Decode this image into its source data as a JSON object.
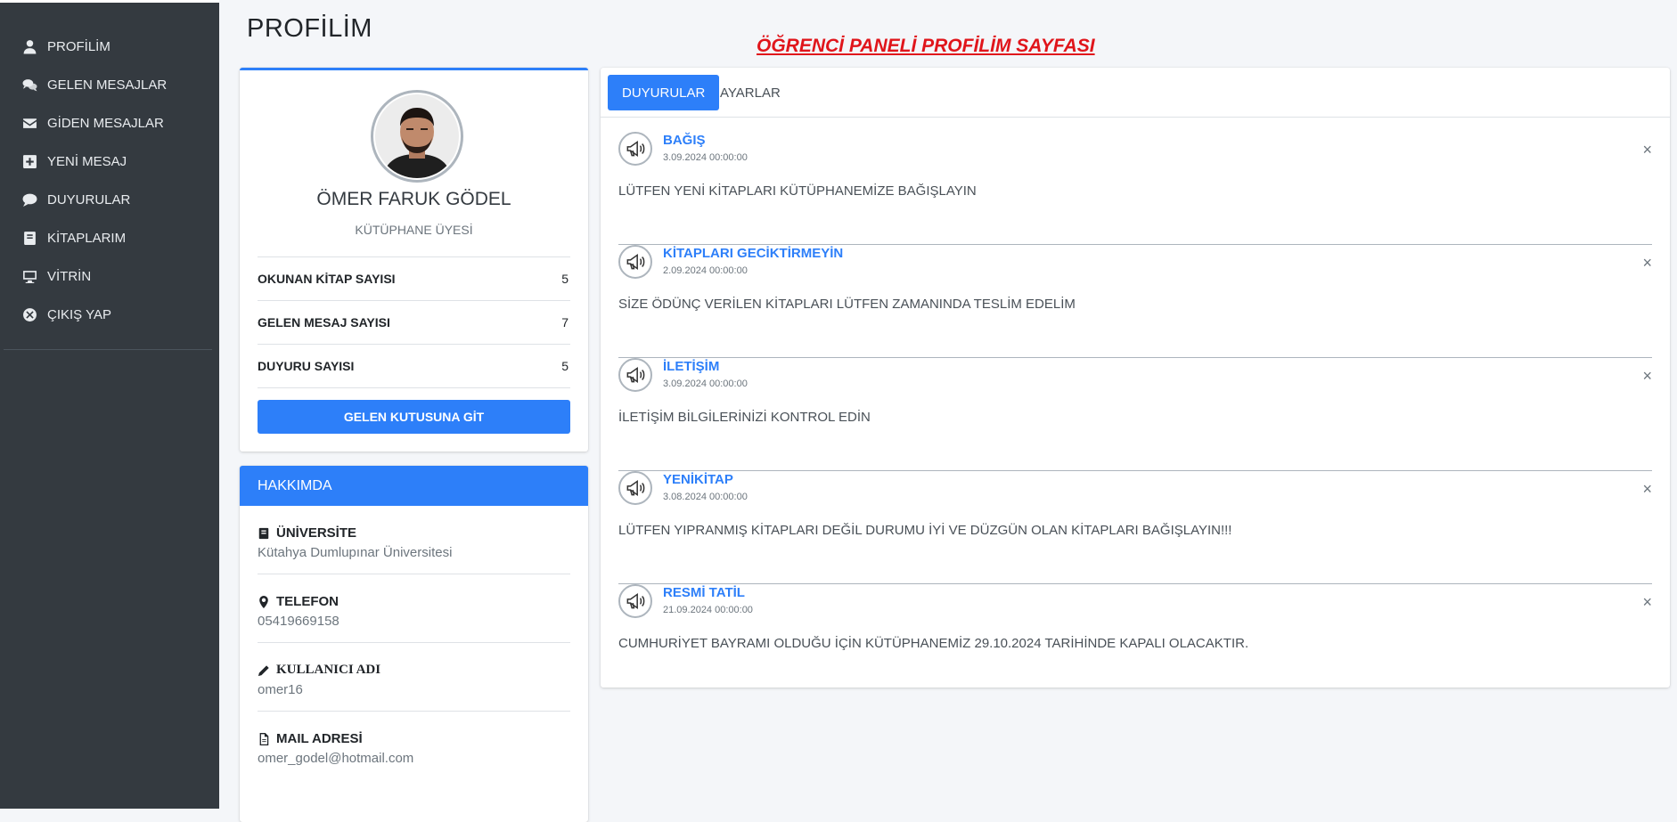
{
  "sidebar": {
    "items": [
      {
        "label": "PROFİLİM",
        "icon": "user-icon"
      },
      {
        "label": "GELEN MESAJLAR",
        "icon": "comments-icon"
      },
      {
        "label": "GİDEN MESAJLAR",
        "icon": "envelope-icon"
      },
      {
        "label": "YENİ MESAJ",
        "icon": "plus-square-icon"
      },
      {
        "label": "DUYURULAR",
        "icon": "comment-icon"
      },
      {
        "label": "KİTAPLARIM",
        "icon": "book-icon"
      },
      {
        "label": "VİTRİN",
        "icon": "desktop-icon"
      },
      {
        "label": "ÇIKIŞ YAP",
        "icon": "times-circle-icon"
      }
    ]
  },
  "header": {
    "title": "PROFİLİM",
    "banner": "ÖĞRENCİ PANELİ PROFİLİM SAYFASI"
  },
  "profile": {
    "name": "ÖMER FARUK GÖDEL",
    "role": "KÜTÜPHANE ÜYESİ",
    "stats": [
      {
        "label": "OKUNAN KİTAP SAYISI",
        "value": "5"
      },
      {
        "label": "GELEN MESAJ SAYISI",
        "value": "7"
      },
      {
        "label": "DUYURU SAYISI",
        "value": "5"
      }
    ],
    "button_label": "GELEN KUTUSUNA GİT"
  },
  "about": {
    "title": "HAKKIMDA",
    "items": [
      {
        "label": "ÜNİVERSİTE",
        "value": "Kütahya Dumlupınar Üniversitesi",
        "icon": "book-icon"
      },
      {
        "label": "TELEFON",
        "value": "05419669158",
        "icon": "map-marker-icon"
      },
      {
        "label": "KULLANICI ADI",
        "value": "omer16",
        "icon": "pencil-icon"
      },
      {
        "label": "MAIL ADRESİ",
        "value": "omer_godel@hotmail.com",
        "icon": "file-icon"
      }
    ]
  },
  "tabs": [
    {
      "label": "DUYURULAR",
      "active": true
    },
    {
      "label": "AYARLAR",
      "active": false
    }
  ],
  "announcements": [
    {
      "title": "BAĞIŞ",
      "date": "3.09.2024 00:00:00",
      "text": "LÜTFEN YENİ KİTAPLARI KÜTÜPHANEMİZE BAĞIŞLAYIN"
    },
    {
      "title": "KİTAPLARI GECİKTİRMEYİN",
      "date": "2.09.2024 00:00:00",
      "text": "SİZE ÖDÜNÇ VERİLEN KİTAPLARI LÜTFEN ZAMANINDA TESLİM EDELİM"
    },
    {
      "title": "İLETİŞİM",
      "date": "3.09.2024 00:00:00",
      "text": "İLETİŞİM BİLGİLERİNİZİ KONTROL EDİN"
    },
    {
      "title": "YENİKİTAP",
      "date": "3.08.2024 00:00:00",
      "text": "LÜTFEN YIPRANMIŞ KİTAPLARI DEĞİL DURUMU İYİ VE DÜZGÜN OLAN KİTAPLARI BAĞIŞLAYIN!!!"
    },
    {
      "title": "RESMİ TATİL",
      "date": "21.09.2024 00:00:00",
      "text": "CUMHURİYET BAYRAMI OLDUĞU İÇİN KÜTÜPHANEMİZ 29.10.2024 TARİHİNDE KAPALI OLACAKTIR."
    }
  ],
  "close_glyph": "×",
  "colors": {
    "sidebar_bg": "#343a40",
    "primary": "#2d7ff9",
    "banner_red": "#e0151b",
    "page_bg": "#f4f6f9"
  }
}
